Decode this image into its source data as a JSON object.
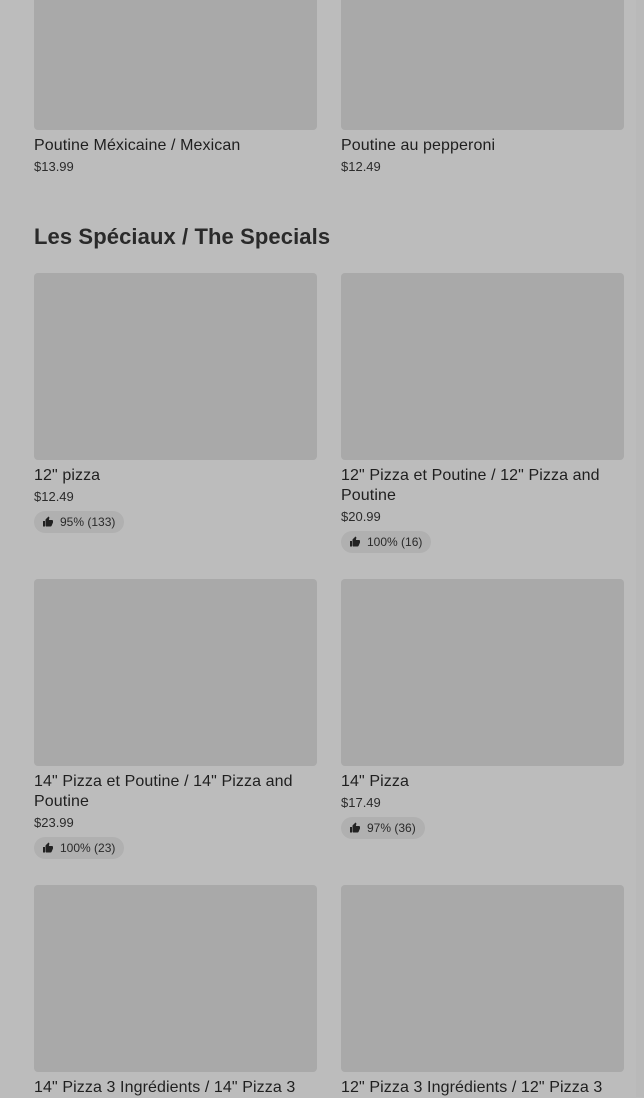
{
  "prev_section": {
    "items": [
      {
        "name": "Poutine Méxicaine / Mexican",
        "price": "$13.99"
      },
      {
        "name": "Poutine au pepperoni",
        "price": "$12.49"
      }
    ]
  },
  "specials": {
    "title": "Les Spéciaux / The Specials",
    "items": [
      {
        "name": "12\" pizza",
        "price": "$12.49",
        "rating": "95% (133)"
      },
      {
        "name": "12\" Pizza et Poutine / 12\" Pizza and Poutine",
        "price": "$20.99",
        "rating": "100% (16)"
      },
      {
        "name": "14\" Pizza et Poutine / 14\" Pizza and Poutine",
        "price": "$23.99",
        "rating": "100% (23)"
      },
      {
        "name": "14\" Pizza",
        "price": "$17.49",
        "rating": "97% (36)"
      },
      {
        "name": "14\" Pizza 3 Ingrédients / 14\" Pizza 3",
        "price": ""
      },
      {
        "name": "12\" Pizza 3 Ingrédients / 12\" Pizza 3",
        "price": ""
      }
    ]
  },
  "icons": {
    "rating": "thumbs-up-icon"
  }
}
